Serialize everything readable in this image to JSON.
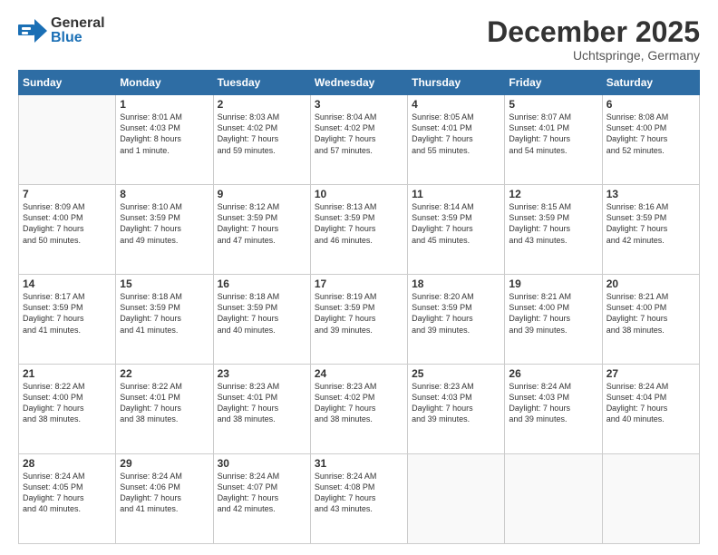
{
  "logo": {
    "line1": "General",
    "line2": "Blue"
  },
  "title": "December 2025",
  "location": "Uchtspringe, Germany",
  "days_header": [
    "Sunday",
    "Monday",
    "Tuesday",
    "Wednesday",
    "Thursday",
    "Friday",
    "Saturday"
  ],
  "weeks": [
    [
      {
        "day": "",
        "info": ""
      },
      {
        "day": "1",
        "info": "Sunrise: 8:01 AM\nSunset: 4:03 PM\nDaylight: 8 hours\nand 1 minute."
      },
      {
        "day": "2",
        "info": "Sunrise: 8:03 AM\nSunset: 4:02 PM\nDaylight: 7 hours\nand 59 minutes."
      },
      {
        "day": "3",
        "info": "Sunrise: 8:04 AM\nSunset: 4:02 PM\nDaylight: 7 hours\nand 57 minutes."
      },
      {
        "day": "4",
        "info": "Sunrise: 8:05 AM\nSunset: 4:01 PM\nDaylight: 7 hours\nand 55 minutes."
      },
      {
        "day": "5",
        "info": "Sunrise: 8:07 AM\nSunset: 4:01 PM\nDaylight: 7 hours\nand 54 minutes."
      },
      {
        "day": "6",
        "info": "Sunrise: 8:08 AM\nSunset: 4:00 PM\nDaylight: 7 hours\nand 52 minutes."
      }
    ],
    [
      {
        "day": "7",
        "info": "Sunrise: 8:09 AM\nSunset: 4:00 PM\nDaylight: 7 hours\nand 50 minutes."
      },
      {
        "day": "8",
        "info": "Sunrise: 8:10 AM\nSunset: 3:59 PM\nDaylight: 7 hours\nand 49 minutes."
      },
      {
        "day": "9",
        "info": "Sunrise: 8:12 AM\nSunset: 3:59 PM\nDaylight: 7 hours\nand 47 minutes."
      },
      {
        "day": "10",
        "info": "Sunrise: 8:13 AM\nSunset: 3:59 PM\nDaylight: 7 hours\nand 46 minutes."
      },
      {
        "day": "11",
        "info": "Sunrise: 8:14 AM\nSunset: 3:59 PM\nDaylight: 7 hours\nand 45 minutes."
      },
      {
        "day": "12",
        "info": "Sunrise: 8:15 AM\nSunset: 3:59 PM\nDaylight: 7 hours\nand 43 minutes."
      },
      {
        "day": "13",
        "info": "Sunrise: 8:16 AM\nSunset: 3:59 PM\nDaylight: 7 hours\nand 42 minutes."
      }
    ],
    [
      {
        "day": "14",
        "info": "Sunrise: 8:17 AM\nSunset: 3:59 PM\nDaylight: 7 hours\nand 41 minutes."
      },
      {
        "day": "15",
        "info": "Sunrise: 8:18 AM\nSunset: 3:59 PM\nDaylight: 7 hours\nand 41 minutes."
      },
      {
        "day": "16",
        "info": "Sunrise: 8:18 AM\nSunset: 3:59 PM\nDaylight: 7 hours\nand 40 minutes."
      },
      {
        "day": "17",
        "info": "Sunrise: 8:19 AM\nSunset: 3:59 PM\nDaylight: 7 hours\nand 39 minutes."
      },
      {
        "day": "18",
        "info": "Sunrise: 8:20 AM\nSunset: 3:59 PM\nDaylight: 7 hours\nand 39 minutes."
      },
      {
        "day": "19",
        "info": "Sunrise: 8:21 AM\nSunset: 4:00 PM\nDaylight: 7 hours\nand 39 minutes."
      },
      {
        "day": "20",
        "info": "Sunrise: 8:21 AM\nSunset: 4:00 PM\nDaylight: 7 hours\nand 38 minutes."
      }
    ],
    [
      {
        "day": "21",
        "info": "Sunrise: 8:22 AM\nSunset: 4:00 PM\nDaylight: 7 hours\nand 38 minutes."
      },
      {
        "day": "22",
        "info": "Sunrise: 8:22 AM\nSunset: 4:01 PM\nDaylight: 7 hours\nand 38 minutes."
      },
      {
        "day": "23",
        "info": "Sunrise: 8:23 AM\nSunset: 4:01 PM\nDaylight: 7 hours\nand 38 minutes."
      },
      {
        "day": "24",
        "info": "Sunrise: 8:23 AM\nSunset: 4:02 PM\nDaylight: 7 hours\nand 38 minutes."
      },
      {
        "day": "25",
        "info": "Sunrise: 8:23 AM\nSunset: 4:03 PM\nDaylight: 7 hours\nand 39 minutes."
      },
      {
        "day": "26",
        "info": "Sunrise: 8:24 AM\nSunset: 4:03 PM\nDaylight: 7 hours\nand 39 minutes."
      },
      {
        "day": "27",
        "info": "Sunrise: 8:24 AM\nSunset: 4:04 PM\nDaylight: 7 hours\nand 40 minutes."
      }
    ],
    [
      {
        "day": "28",
        "info": "Sunrise: 8:24 AM\nSunset: 4:05 PM\nDaylight: 7 hours\nand 40 minutes."
      },
      {
        "day": "29",
        "info": "Sunrise: 8:24 AM\nSunset: 4:06 PM\nDaylight: 7 hours\nand 41 minutes."
      },
      {
        "day": "30",
        "info": "Sunrise: 8:24 AM\nSunset: 4:07 PM\nDaylight: 7 hours\nand 42 minutes."
      },
      {
        "day": "31",
        "info": "Sunrise: 8:24 AM\nSunset: 4:08 PM\nDaylight: 7 hours\nand 43 minutes."
      },
      {
        "day": "",
        "info": ""
      },
      {
        "day": "",
        "info": ""
      },
      {
        "day": "",
        "info": ""
      }
    ]
  ]
}
